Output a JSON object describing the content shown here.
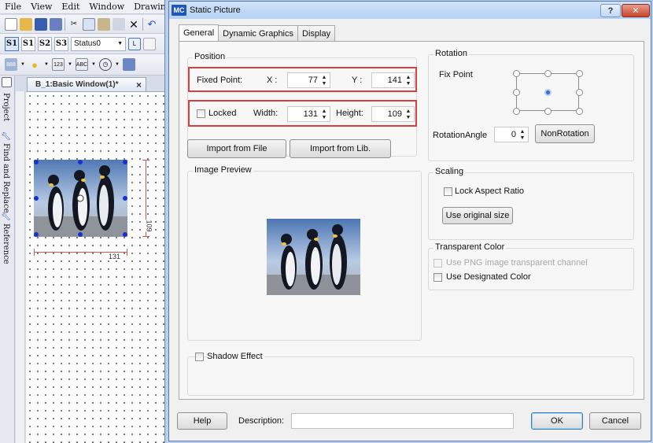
{
  "ide": {
    "menu": [
      "File",
      "View",
      "Edit",
      "Window",
      "Drawing"
    ],
    "status_combo": "Status0",
    "state_buttons": [
      "S1",
      "S1",
      "S2",
      "S3"
    ],
    "side_tabs": [
      "Project",
      "Find and Replace",
      "Reference"
    ],
    "doc_tab": {
      "label": "B_1:Basic Window(1)*",
      "close": "×"
    },
    "canvas_dims": {
      "width_label": "131",
      "height_label": "109"
    }
  },
  "dialog": {
    "badge": "MC",
    "title": "Static Picture",
    "help_glyph": "?",
    "close_glyph": "✕",
    "tabs": [
      "General",
      "Dynamic Graphics",
      "Display"
    ],
    "position": {
      "title": "Position",
      "fixed_point_label": "Fixed Point:",
      "x_label": "X :",
      "x_value": "77",
      "y_label": "Y :",
      "y_value": "141",
      "locked_label": "Locked",
      "width_label": "Width:",
      "width_value": "131",
      "height_label": "Height:",
      "height_value": "109"
    },
    "import": {
      "from_file": "Import from File",
      "from_lib": "Import from Lib."
    },
    "image_preview_title": "Image Preview",
    "rotation": {
      "title": "Rotation",
      "fix_point_label": "Fix Point",
      "angle_label": "RotationAngle",
      "angle_value": "0",
      "non_rotation": "NonRotation"
    },
    "scaling": {
      "title": "Scaling",
      "lock_aspect": "Lock Aspect Ratio",
      "use_original": "Use original size"
    },
    "transparent": {
      "title": "Transparent Color",
      "png_channel": "Use PNG image transparent channel",
      "designated": "Use Designated Color"
    },
    "shadow_label": "Shadow Effect",
    "footer": {
      "help": "Help",
      "description_label": "Description:",
      "description_value": "",
      "ok": "OK",
      "cancel": "Cancel"
    }
  }
}
